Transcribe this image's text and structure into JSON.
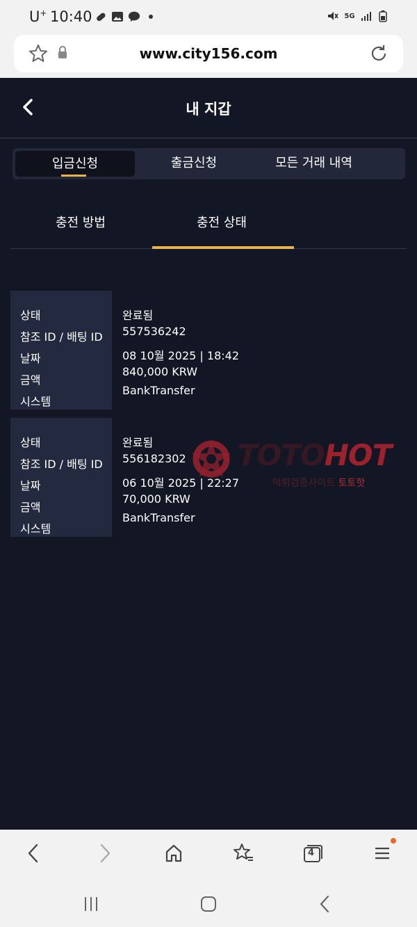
{
  "status_bar": {
    "carrier": "U",
    "carrier_sup": "+",
    "time": "10:40",
    "network": "5G"
  },
  "browser": {
    "url": "www.city156.com",
    "tab_count": "4"
  },
  "header": {
    "title": "내 지갑"
  },
  "tabs": [
    {
      "label": "입금신청"
    },
    {
      "label": "출금신청"
    },
    {
      "label": "모든 거래 내역"
    }
  ],
  "subtabs": [
    {
      "label": "충전 방법"
    },
    {
      "label": "충전 상태"
    }
  ],
  "records": [
    {
      "labels": [
        "상태",
        "참조 ID / 배팅 ID",
        "날짜",
        "금액",
        "시스템"
      ],
      "values": [
        "완료됨",
        "557536242",
        "08 10월 2025 | 18:42",
        "840,000 KRW",
        "BankTransfer"
      ]
    },
    {
      "labels": [
        "상태",
        "참조 ID / 배팅 ID",
        "날짜",
        "금액",
        "시스템"
      ],
      "values": [
        "완료됨",
        "556182302",
        "06 10월 2025 | 22:27",
        "70,000 KRW",
        "BankTransfer"
      ]
    }
  ],
  "watermark": {
    "text_a": "TOTO",
    "text_b": "HOT",
    "sub_a": "먹튀검증사이트 ",
    "sub_b": "토토핫"
  },
  "colors": {
    "background": "#131624",
    "accent": "#e8b44a",
    "label_panel": "#232a3f"
  }
}
